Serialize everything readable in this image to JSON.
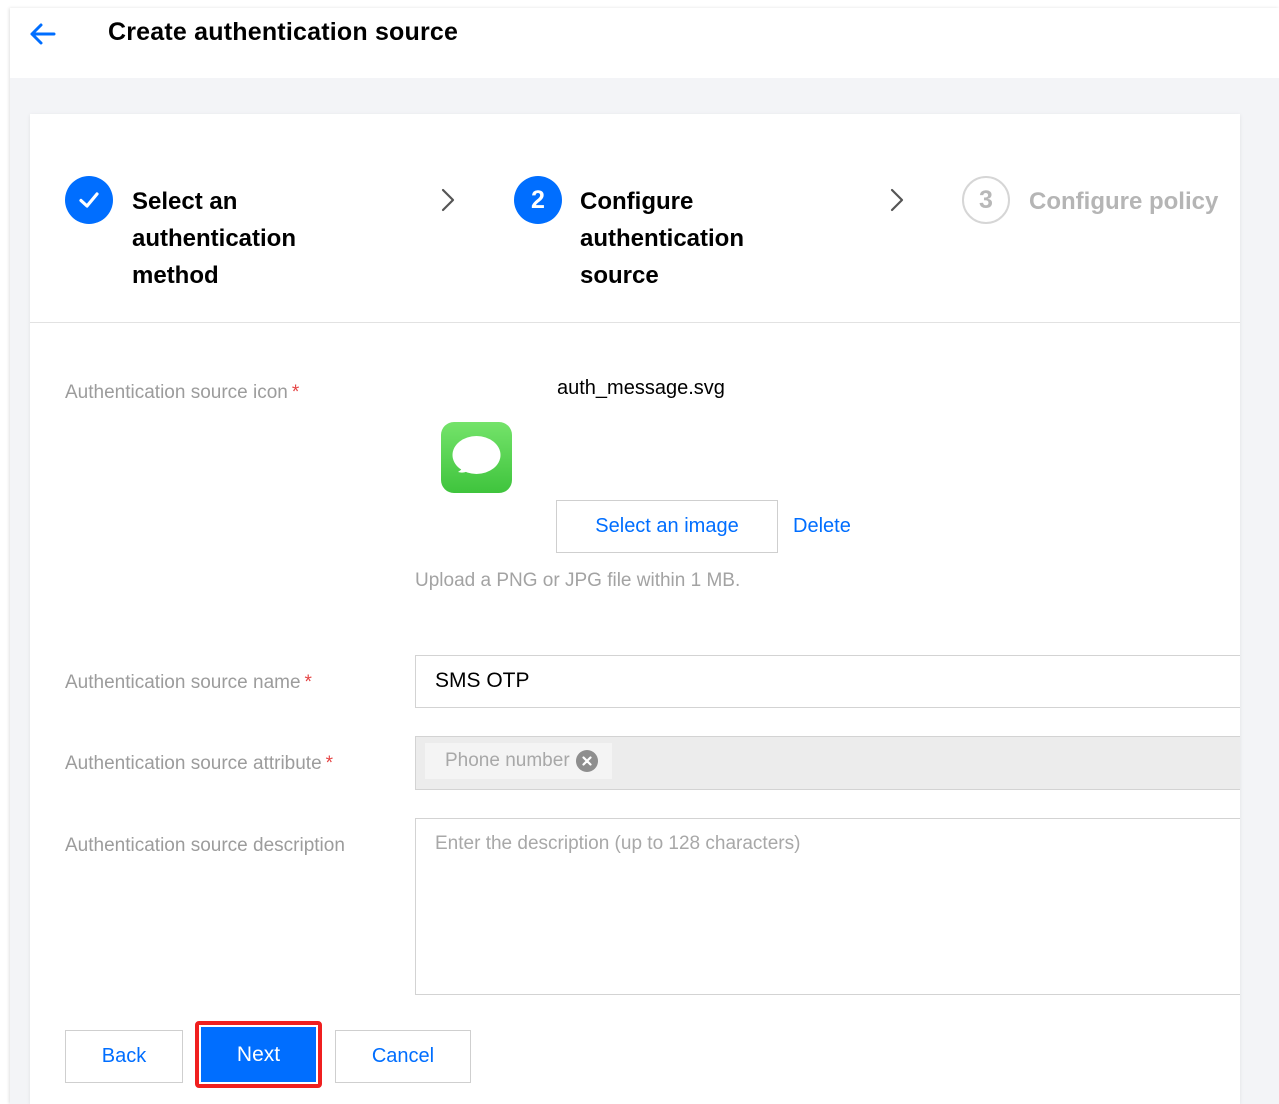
{
  "header": {
    "title": "Create authentication source",
    "back_icon": "arrow-left-icon"
  },
  "steps": [
    {
      "number": "1",
      "label_lines": [
        "Select an",
        "authentication",
        "method"
      ],
      "status": "done"
    },
    {
      "number": "2",
      "label_lines": [
        "Configure",
        "authentication",
        "source"
      ],
      "status": "active"
    },
    {
      "number": "3",
      "label_lines": [
        "Configure policy"
      ],
      "status": "todo"
    }
  ],
  "form": {
    "icon_field": {
      "label": "Authentication source icon",
      "required_mark": "*",
      "filename": "auth_message.svg",
      "icon": "message-bubble-icon",
      "select_button": "Select an image",
      "delete_link": "Delete",
      "hint": "Upload a PNG or JPG file within 1 MB."
    },
    "name_field": {
      "label": "Authentication source name",
      "required_mark": "*",
      "value": "SMS OTP"
    },
    "attribute_field": {
      "label": "Authentication source attribute",
      "required_mark": "*",
      "tag": "Phone number"
    },
    "description_field": {
      "label": "Authentication source description",
      "placeholder": "Enter the description (up to 128 characters)"
    }
  },
  "footer": {
    "back": "Back",
    "next": "Next",
    "cancel": "Cancel"
  },
  "colors": {
    "accent": "#006eff",
    "highlight": "#f01f1f",
    "required": "#e54545"
  }
}
